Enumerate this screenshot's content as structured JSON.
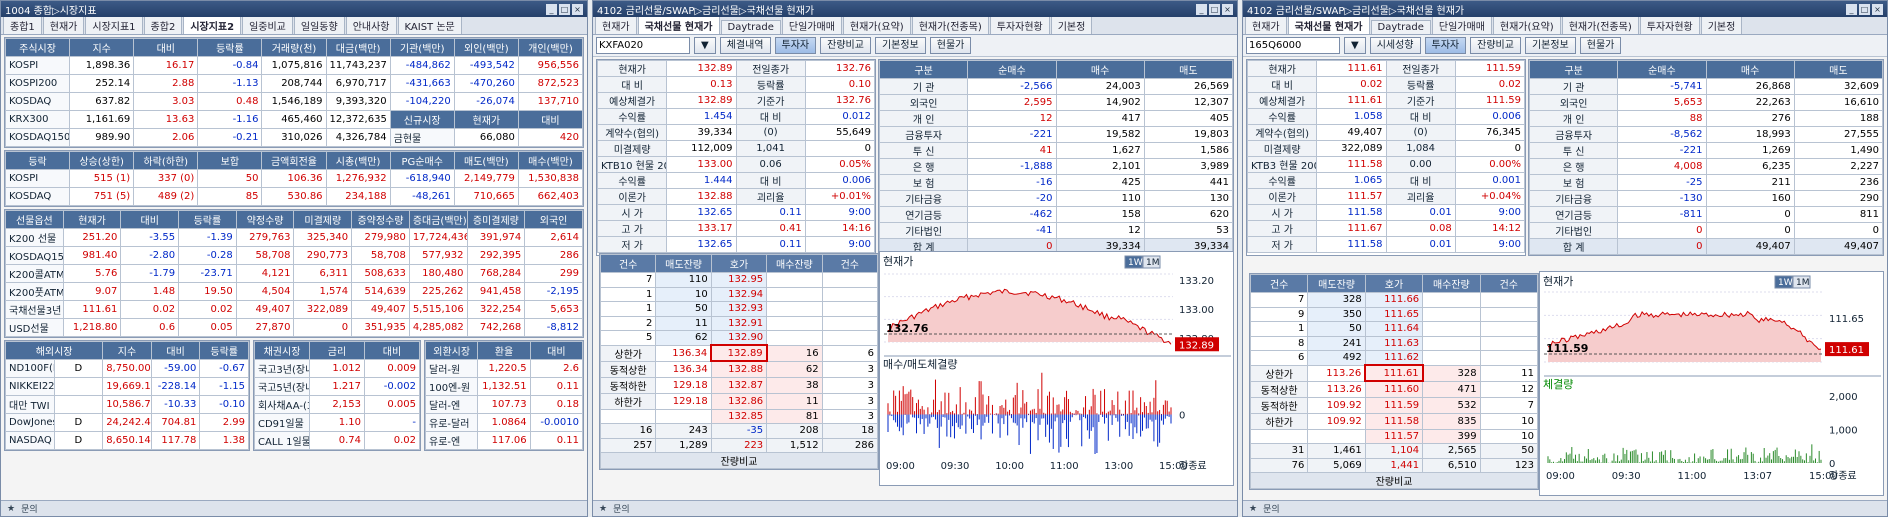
{
  "w1": {
    "title": "1004 종합▷시장지표",
    "tabs": [
      "종합1",
      "현재가",
      "시장지표1",
      "종합2",
      "시장지표2",
      "일중비교",
      "일일동향",
      "안내사항",
      "KAIST 논문"
    ],
    "active_tab": 4,
    "stock": {
      "headers": [
        "주식시장",
        "지수",
        "대비",
        "등락률",
        "거래량(천)",
        "대금(백만)",
        "기관(백만)",
        "외인(백만)",
        "개인(백만)"
      ],
      "rows": [
        [
          "KOSPI",
          "1,898.36",
          "16.17",
          "-0.84",
          "1,075,816",
          "11,743,237",
          "-484,862",
          "-493,542",
          "956,556"
        ],
        [
          "KOSPI200",
          "252.14",
          "2.88",
          "-1.13",
          "208,744",
          "6,970,717",
          "-431,663",
          "-470,260",
          "872,523"
        ],
        [
          "KOSDAQ",
          "637.82",
          "3.03",
          "0.48",
          "1,546,189",
          "9,393,320",
          "-104,220",
          "-26,074",
          "137,710"
        ],
        [
          "KRX300",
          "1,161.69",
          "13.63",
          "-1.16",
          "465,460",
          "12,372,635",
          "",
          "",
          ""
        ],
        [
          "KOSDAQ150",
          "989.90",
          "2.06",
          "-0.21",
          "310,026",
          "4,326,784",
          "",
          "",
          ""
        ]
      ],
      "new_hdr": [
        "신규시장",
        "현재가",
        "대비"
      ],
      "new_row": [
        "금현물",
        "66,080",
        "420"
      ]
    },
    "adr": {
      "headers": [
        "등락",
        "상승(상한)",
        "하락(하한)",
        "보합",
        "금액회전율",
        "시총(백만)",
        "PG순매수",
        "매도(백만)",
        "매수(백만)"
      ],
      "rows": [
        [
          "KOSPI",
          "515 (1)",
          "337 (0)",
          "50",
          "106.36",
          "1,276,932",
          "-618,940",
          "2,149,779",
          "1,530,838"
        ],
        [
          "KOSDAQ",
          "751 (5)",
          "489 (2)",
          "85",
          "530.86",
          "234,188",
          "-48,261",
          "710,665",
          "662,403"
        ]
      ]
    },
    "fut": {
      "headers": [
        "선물옵션",
        "현재가",
        "대비",
        "등락률",
        "약정수량",
        "미결제량",
        "증약정수량",
        "증대금(백만)",
        "증미결제량",
        "외국인"
      ],
      "rows": [
        [
          "K200 선물",
          "251.20",
          "-3.55",
          "-1.39",
          "279,763",
          "325,340",
          "279,980",
          "17,724,436",
          "391,974",
          "2,614"
        ],
        [
          "KOSDAQ150 선물",
          "981.40",
          "-2.80",
          "-0.28",
          "58,708",
          "290,773",
          "58,708",
          "577,932",
          "292,395",
          "286"
        ],
        [
          "K200콜ATM",
          "5.76",
          "-1.79",
          "-23.71",
          "4,121",
          "6,311",
          "508,633",
          "180,480",
          "768,284",
          "299"
        ],
        [
          "K200풋ATM",
          "9.07",
          "1.48",
          "19.50",
          "4,504",
          "1,574",
          "514,639",
          "225,262",
          "941,458",
          "-2,195"
        ],
        [
          "국채선물3년",
          "111.61",
          "0.02",
          "0.02",
          "49,407",
          "322,089",
          "49,407",
          "5,515,106",
          "322,254",
          "5,653"
        ],
        [
          "USD선물",
          "1,218.80",
          "0.6",
          "0.05",
          "27,870",
          "0",
          "351,935",
          "4,285,082",
          "742,268",
          "-8,812"
        ]
      ]
    },
    "ovs": {
      "headers": [
        "해외시장",
        "지수",
        "대비",
        "등락률"
      ],
      "rows": [
        [
          "ND100F(E)",
          "D",
          "8,750.00",
          "-59.00",
          "-0.67"
        ],
        [
          "NIKKEI225",
          "",
          "19,669.12",
          "-228.14",
          "-1.15"
        ],
        [
          "대만 TWI",
          "",
          "10,586.71",
          "-10.33",
          "-0.10"
        ],
        [
          "DowJones",
          "D",
          "24,242.49",
          "704.81",
          "2.99"
        ],
        [
          "NASDAQ",
          "D",
          "8,650.14",
          "117.78",
          "1.38"
        ]
      ]
    },
    "bond": {
      "headers": [
        "채권시장",
        "금리",
        "대비"
      ],
      "rows": [
        [
          "국고3년(장내)",
          "1.012",
          "0.009"
        ],
        [
          "국고5년(장내)",
          "1.217",
          "-0.002"
        ],
        [
          "회사채AA-(3)",
          "2,153",
          "0.005"
        ],
        [
          "CD91일물",
          "1.10",
          "-"
        ],
        [
          "CALL 1일물",
          "0.74",
          "0.02"
        ]
      ]
    },
    "fx": {
      "headers": [
        "외환시장",
        "환율",
        "대비"
      ],
      "rows": [
        [
          "달러-원",
          "1,220.5",
          "2.6"
        ],
        [
          "100엔-원",
          "1,132.51",
          "0.11"
        ],
        [
          "달러-엔",
          "107.73",
          "0.18"
        ],
        [
          "유로-달러",
          "1.0864",
          "-0.0010"
        ],
        [
          "유로-엔",
          "117.06",
          "0.11"
        ]
      ]
    }
  },
  "w2": {
    "title": "4102 금리선물/SWAP▷금리선물▷국채선물 현재가",
    "tabs": [
      "현재가",
      "국채선물 현재가",
      "Daytrade",
      "단일가매매",
      "현재가(요약)",
      "현재가(전종목)",
      "투자자현황",
      "기본정"
    ],
    "active_tab": 1,
    "code": "KXFA020",
    "buttons": [
      "체결내역",
      "투자자",
      "잔량비교",
      "기본정보",
      "현물가"
    ],
    "active_btn": 1,
    "quote": [
      [
        "현재가",
        "132.89",
        "전일종가",
        "132.76"
      ],
      [
        "대 비",
        "0.13",
        "등락률",
        "0.10"
      ],
      [
        "예상체결가",
        "132.89",
        "기준가",
        "132.76"
      ],
      [
        "수익률",
        "1.454",
        "대 비",
        "0.012"
      ],
      [
        "계약수(협의)",
        "39,334",
        "(0)",
        "55,649"
      ],
      [
        "미결제량",
        "112,009",
        "1,041",
        "0"
      ],
      [
        "KTB10 현물 200",
        "133.00",
        "0.06",
        "0.05%"
      ],
      [
        "수익률",
        "1.444",
        "대 비",
        "0.006"
      ],
      [
        "이론가",
        "132.88",
        "괴리율",
        "+0.01%"
      ],
      [
        "시 가",
        "132.65",
        "0.11",
        "9:00"
      ],
      [
        "고 가",
        "133.17",
        "0.41",
        "14:16"
      ],
      [
        "저 가",
        "132.65",
        "0.11",
        "9:00"
      ]
    ],
    "inv_headers": [
      "구분",
      "순매수",
      "매수",
      "매도"
    ],
    "inv": [
      [
        "기 관",
        "-2,566",
        "24,003",
        "26,569"
      ],
      [
        "외국인",
        "2,595",
        "14,902",
        "12,307"
      ],
      [
        "개 인",
        "12",
        "417",
        "405"
      ],
      [
        "금융투자",
        "-221",
        "19,582",
        "19,803"
      ],
      [
        "투 신",
        "41",
        "1,627",
        "1,586"
      ],
      [
        "은 행",
        "-1,888",
        "2,101",
        "3,989"
      ],
      [
        "보 험",
        "-16",
        "425",
        "441"
      ],
      [
        "기타금융",
        "-20",
        "110",
        "130"
      ],
      [
        "연기금등",
        "-462",
        "158",
        "620"
      ],
      [
        "기타법인",
        "-41",
        "12",
        "53"
      ],
      [
        "합 계",
        "0",
        "39,334",
        "39,334"
      ]
    ],
    "ob_headers": [
      "건수",
      "매도잔량",
      "호가",
      "매수잔량",
      "건수"
    ],
    "asks": [
      [
        "7",
        "110",
        "132.95"
      ],
      [
        "1",
        "10",
        "132.94"
      ],
      [
        "1",
        "50",
        "132.93"
      ],
      [
        "2",
        "11",
        "132.91"
      ],
      [
        "5",
        "62",
        "132.90"
      ]
    ],
    "bids": [
      [
        "132.89",
        "16",
        "6"
      ],
      [
        "132.88",
        "62",
        "3"
      ],
      [
        "132.87",
        "38",
        "3"
      ],
      [
        "132.86",
        "11",
        "3"
      ],
      [
        "132.85",
        "81",
        "3"
      ]
    ],
    "limits": [
      [
        "상한가",
        "136.34"
      ],
      [
        "동적상한",
        "136.34"
      ],
      [
        "동적하한",
        "129.18"
      ],
      [
        "하한가",
        "129.18"
      ]
    ],
    "ob_tot1": [
      "16",
      "243",
      "-35",
      "208",
      "18"
    ],
    "ob_tot2": [
      "257",
      "1,289",
      "223",
      "1,512",
      "286"
    ],
    "ob_footer": "잔량비교",
    "chart": {
      "title": "현재가",
      "ylabels": [
        "133.20",
        "133.00",
        "132.80"
      ],
      "last": "132.89",
      "start": "132.76",
      "sub_title": "매수/매도체결량",
      "sub_zero": "0",
      "xlabels": [
        "09:00",
        "09:30",
        "10:00",
        "11:00",
        "13:00",
        "15:00"
      ],
      "end_label": "장종료",
      "periods": [
        "1W",
        "1M"
      ]
    }
  },
  "w3": {
    "title": "4102 금리선물/SWAP▷금리선물▷국채선물 현재가",
    "tabs": [
      "현재가",
      "국채선물 현재가",
      "Daytrade",
      "단일가매매",
      "현재가(요약)",
      "현재가(전종목)",
      "투자자현황",
      "기본정"
    ],
    "active_tab": 1,
    "code": "165Q6000",
    "buttons": [
      "시세성향",
      "투자자",
      "잔량비교",
      "기본정보",
      "현물가"
    ],
    "active_btn": 1,
    "quote": [
      [
        "현재가",
        "111.61",
        "전일종가",
        "111.59"
      ],
      [
        "대 비",
        "0.02",
        "등락률",
        "0.02"
      ],
      [
        "예상체결가",
        "111.61",
        "기준가",
        "111.59"
      ],
      [
        "수익률",
        "1.058",
        "대 비",
        "0.006"
      ],
      [
        "계약수(협의)",
        "49,407",
        "(0)",
        "76,345"
      ],
      [
        "미결제량",
        "322,089",
        "1,084",
        "0"
      ],
      [
        "KTB3 현물 200",
        "111.58",
        "0.00",
        "0.00%"
      ],
      [
        "수익률",
        "1.065",
        "대 비",
        "0.001"
      ],
      [
        "이론가",
        "111.57",
        "괴리율",
        "+0.04%"
      ],
      [
        "시 가",
        "111.58",
        "0.01",
        "9:00"
      ],
      [
        "고 가",
        "111.67",
        "0.08",
        "14:12"
      ],
      [
        "저 가",
        "111.58",
        "0.01",
        "9:00"
      ]
    ],
    "inv_headers": [
      "구분",
      "순매수",
      "매수",
      "매도"
    ],
    "inv": [
      [
        "기 관",
        "-5,741",
        "26,868",
        "32,609"
      ],
      [
        "외국인",
        "5,653",
        "22,263",
        "16,610"
      ],
      [
        "개 인",
        "88",
        "276",
        "188"
      ],
      [
        "금융투자",
        "-8,562",
        "18,993",
        "27,555"
      ],
      [
        "투 신",
        "-221",
        "1,269",
        "1,490"
      ],
      [
        "은 행",
        "4,008",
        "6,235",
        "2,227"
      ],
      [
        "보 험",
        "-25",
        "211",
        "236"
      ],
      [
        "기타금융",
        "-130",
        "160",
        "290"
      ],
      [
        "연기금등",
        "-811",
        "0",
        "811"
      ],
      [
        "기타법인",
        "0",
        "0",
        "0"
      ],
      [
        "합 계",
        "0",
        "49,407",
        "49,407"
      ]
    ],
    "ob_headers": [
      "건수",
      "매도잔량",
      "호가",
      "매수잔량",
      "건수"
    ],
    "asks": [
      [
        "7",
        "328",
        "111.66"
      ],
      [
        "9",
        "350",
        "111.65"
      ],
      [
        "1",
        "50",
        "111.64"
      ],
      [
        "8",
        "241",
        "111.63"
      ],
      [
        "6",
        "492",
        "111.62"
      ]
    ],
    "bids": [
      [
        "111.61",
        "328",
        "11"
      ],
      [
        "111.60",
        "471",
        "12"
      ],
      [
        "111.59",
        "532",
        "7"
      ],
      [
        "111.58",
        "835",
        "10"
      ],
      [
        "111.57",
        "399",
        "10"
      ]
    ],
    "limits": [
      [
        "상한가",
        "113.26"
      ],
      [
        "동적상한",
        "113.26"
      ],
      [
        "동적하한",
        "109.92"
      ],
      [
        "하한가",
        "109.92"
      ]
    ],
    "ob_tot1": [
      "31",
      "1,461",
      "1,104",
      "2,565",
      "50"
    ],
    "ob_tot2": [
      "76",
      "5,069",
      "1,441",
      "6,510",
      "123"
    ],
    "ob_footer": "잔량비교",
    "chart": {
      "title": "현재가",
      "ylabels": [
        "111.65"
      ],
      "last": "111.61",
      "start": "111.59",
      "sub_title": "체결량",
      "sub_ylabels": [
        "2,000",
        "1,000",
        "0"
      ],
      "xlabels": [
        "09:00",
        "09:30",
        "11:00",
        "13:07",
        "15:00"
      ],
      "end_label": "장종료",
      "periods": [
        "1W",
        "1M"
      ]
    }
  },
  "status": {
    "star": "★",
    "label": "문의"
  }
}
